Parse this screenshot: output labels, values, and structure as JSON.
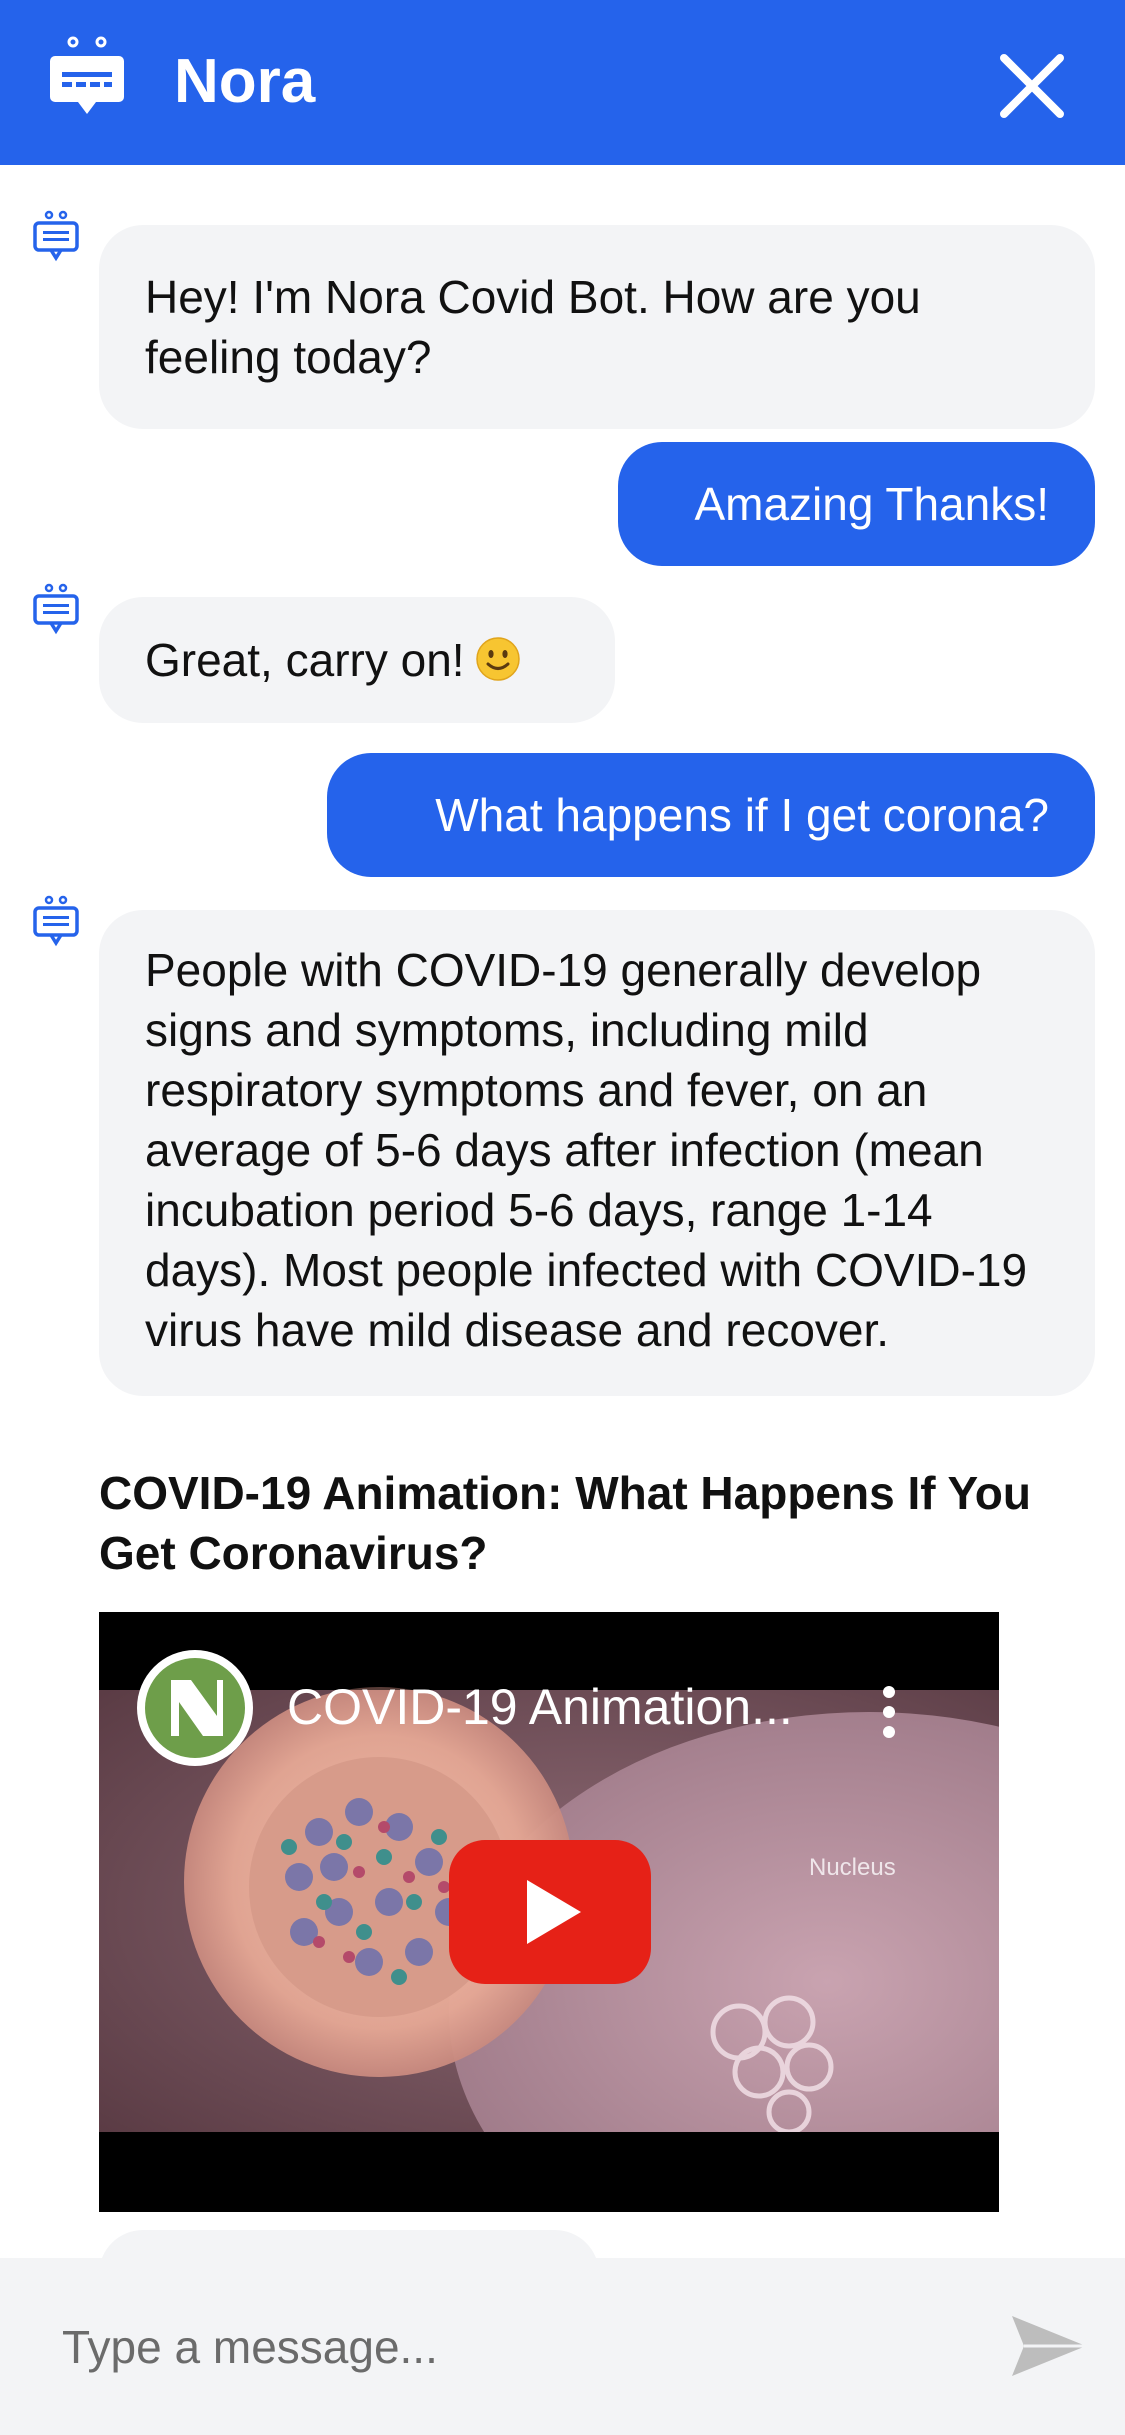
{
  "theme": {
    "accent": "#2563eb"
  },
  "header": {
    "title": "Nora",
    "logo_icon": "chatbot-icon",
    "close_icon": "close-icon"
  },
  "messages": [
    {
      "from": "bot",
      "text": "Hey! I'm Nora Covid Bot. How are you feeling today?"
    },
    {
      "from": "user",
      "text": "Amazing Thanks!"
    },
    {
      "from": "bot",
      "text": "Great, carry on!",
      "emoji": "slightly-smiling-face-icon"
    },
    {
      "from": "user",
      "text": "What happens if I get corona?"
    },
    {
      "from": "bot",
      "text": "People with COVID-19 generally develop signs and symptoms, including mild respiratory symptoms and fever, on an average of 5-6 days after infection (mean incubation period 5-6 days, range 1-14 days). Most people infected with COVID-19 virus have mild disease and recover."
    }
  ],
  "video_card": {
    "heading": "COVID-19 Animation: What Happens If You Get Coronavirus?",
    "player_title": "COVID-19 Animation...",
    "frame_label": "Nucleus",
    "play_icon": "youtube-play-icon",
    "menu_icon": "more-vertical-icon"
  },
  "composer": {
    "value": "",
    "placeholder": "Type a message...",
    "send_icon": "send-icon"
  }
}
